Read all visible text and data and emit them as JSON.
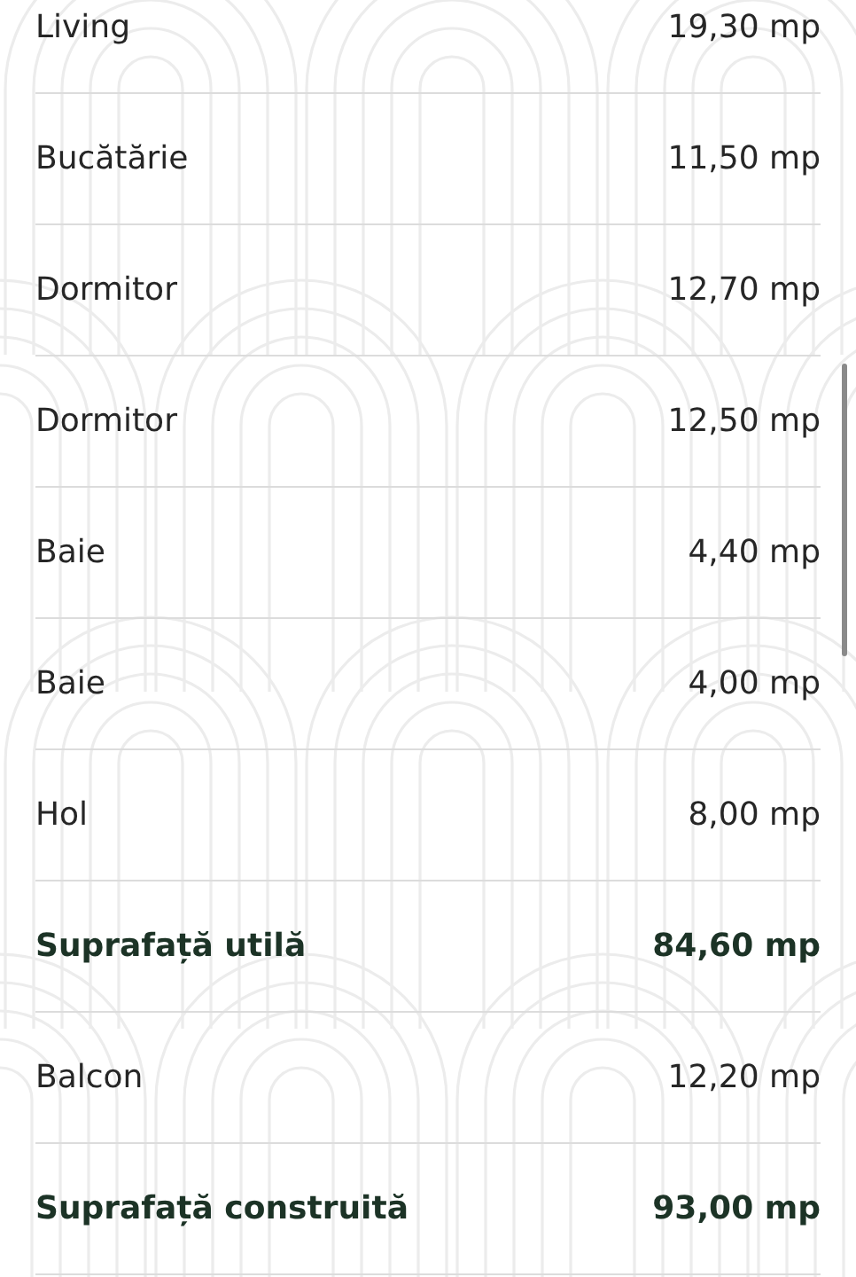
{
  "rows": [
    {
      "kind": "item",
      "label": "Living",
      "value": "19,30 mp"
    },
    {
      "kind": "item",
      "label": "Bucătărie",
      "value": "11,50 mp"
    },
    {
      "kind": "item",
      "label": "Dormitor",
      "value": "12,70 mp"
    },
    {
      "kind": "item",
      "label": "Dormitor",
      "value": "12,50 mp"
    },
    {
      "kind": "item",
      "label": "Baie",
      "value": "4,40 mp"
    },
    {
      "kind": "item",
      "label": "Baie",
      "value": "4,00 mp"
    },
    {
      "kind": "item",
      "label": "Hol",
      "value": "8,00 mp"
    },
    {
      "kind": "total",
      "label": "Suprafață utilă",
      "value": "84,60 mp"
    },
    {
      "kind": "item",
      "label": "Balcon",
      "value": "12,20 mp"
    },
    {
      "kind": "total",
      "label": "Suprafață construită",
      "value": "93,00 mp"
    }
  ]
}
